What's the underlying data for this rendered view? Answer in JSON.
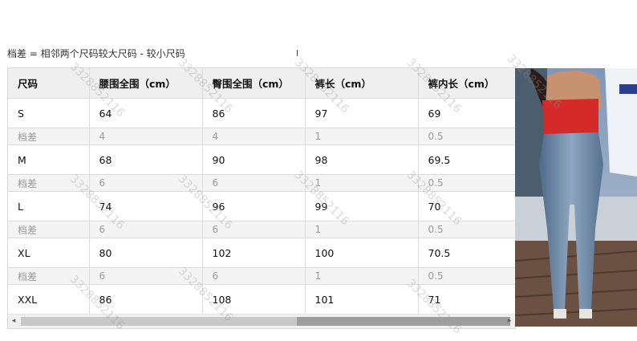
{
  "note": "档差 = 相邻两个尺码较大尺码 - 较小尺码",
  "table": {
    "headers": [
      "尺码",
      "腰围全围（cm）",
      "臀围全围（cm）",
      "裤长（cm）",
      "裤内长（cm）"
    ],
    "rows": [
      {
        "type": "size",
        "cells": [
          "S",
          "64",
          "86",
          "97",
          "69"
        ]
      },
      {
        "type": "diff",
        "cells": [
          "档差",
          "4",
          "4",
          "1",
          "0.5"
        ]
      },
      {
        "type": "size",
        "cells": [
          "M",
          "68",
          "90",
          "98",
          "69.5"
        ]
      },
      {
        "type": "diff",
        "cells": [
          "档差",
          "6",
          "6",
          "1",
          "0.5"
        ]
      },
      {
        "type": "size",
        "cells": [
          "L",
          "74",
          "96",
          "99",
          "70"
        ]
      },
      {
        "type": "diff",
        "cells": [
          "档差",
          "6",
          "6",
          "1",
          "0.5"
        ]
      },
      {
        "type": "size",
        "cells": [
          "XL",
          "80",
          "102",
          "100",
          "70.5"
        ]
      },
      {
        "type": "diff",
        "cells": [
          "档差",
          "6",
          "6",
          "1",
          "0.5"
        ]
      },
      {
        "type": "size",
        "cells": [
          "XXL",
          "86",
          "108",
          "101",
          "71"
        ]
      }
    ]
  },
  "scrollbar": {
    "left_arrow": "◂",
    "right_arrow": "▸"
  },
  "watermark": "3328852116",
  "photo": {
    "description_icon": "model-photo"
  }
}
